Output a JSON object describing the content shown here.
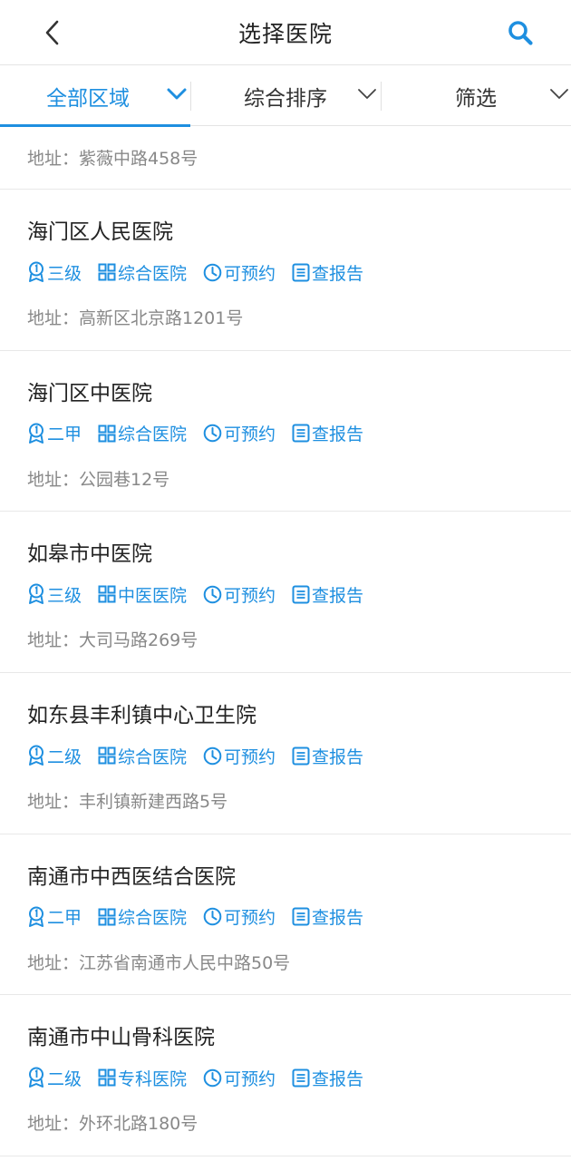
{
  "header": {
    "title": "选择医院"
  },
  "filters": [
    {
      "label": "全部区域",
      "active": true
    },
    {
      "label": "综合排序",
      "active": false
    },
    {
      "label": "筛选",
      "active": false
    }
  ],
  "partial_item": {
    "address": "地址：紫薇中路458号"
  },
  "hospitals": [
    {
      "name": "海门区人民医院",
      "level": "三级",
      "type": "综合医院",
      "booking": "可预约",
      "report": "查报告",
      "address": "地址：高新区北京路1201号"
    },
    {
      "name": "海门区中医院",
      "level": "二甲",
      "type": "综合医院",
      "booking": "可预约",
      "report": "查报告",
      "address": "地址：公园巷12号"
    },
    {
      "name": "如皋市中医院",
      "level": "三级",
      "type": "中医医院",
      "booking": "可预约",
      "report": "查报告",
      "address": "地址：大司马路269号"
    },
    {
      "name": "如东县丰利镇中心卫生院",
      "level": "二级",
      "type": "综合医院",
      "booking": "可预约",
      "report": "查报告",
      "address": "地址：丰利镇新建西路5号"
    },
    {
      "name": "南通市中西医结合医院",
      "level": "二甲",
      "type": "综合医院",
      "booking": "可预约",
      "report": "查报告",
      "address": "地址：江苏省南通市人民中路50号"
    },
    {
      "name": "南通市中山骨科医院",
      "level": "二级",
      "type": "专科医院",
      "booking": "可预约",
      "report": "查报告",
      "address": "地址：外环北路180号"
    }
  ],
  "colors": {
    "accent": "#1e8fe0",
    "text": "#222222",
    "muted": "#888888",
    "divider": "#e8e8e8"
  },
  "icons": {
    "back": "chevron-left-icon",
    "search": "search-icon",
    "level": "award-icon",
    "type": "grid-icon",
    "booking": "clock-icon",
    "report": "document-icon"
  }
}
